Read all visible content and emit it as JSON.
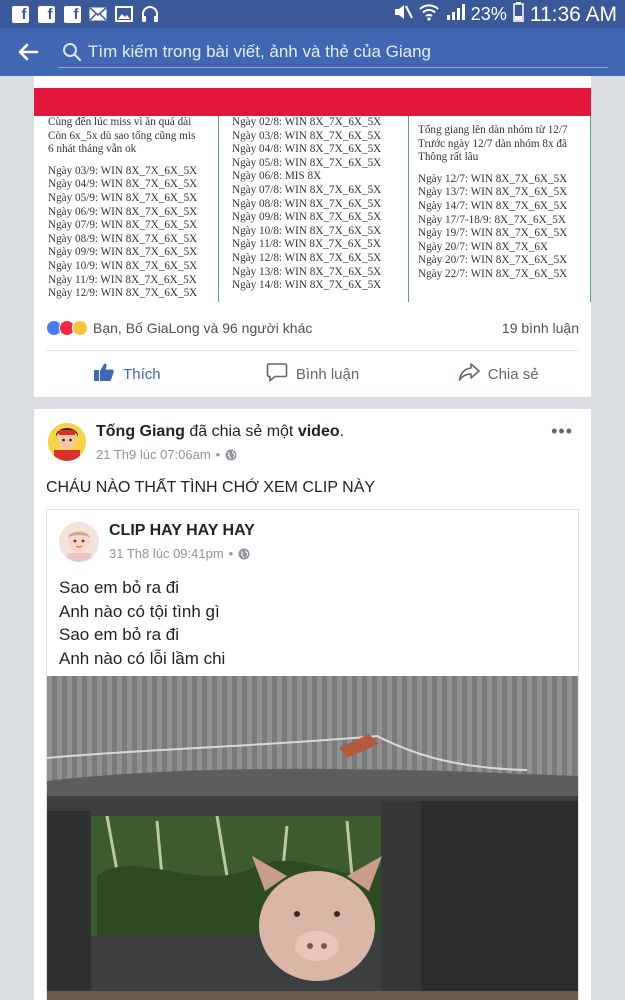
{
  "status_bar": {
    "battery": "23%",
    "time": "11:36 AM"
  },
  "search": {
    "placeholder": "Tìm kiếm trong bài viết, ảnh và thẻ của Giang"
  },
  "post1": {
    "image_text": {
      "col_a": [
        "Cùng đến lúc miss vì ăn quá dài",
        "Còn 6x_5x dù sao tổng cũng mis",
        "6 nhát tháng vẫn ok",
        "",
        "Ngày 03/9: WIN 8X_7X_6X_5X",
        "Ngày 04/9: WIN 8X_7X_6X_5X",
        "Ngày 05/9: WIN 8X_7X_6X_5X",
        "Ngày 06/9: WIN 8X_7X_6X_5X",
        "Ngày 07/9: WIN 8X_7X_6X_5X",
        "Ngày 08/9: WIN 8X_7X_6X_5X",
        "Ngày 09/9: WIN 8X_7X_6X_5X",
        "Ngày 10/9: WIN 8X_7X_6X_5X",
        "Ngày 11/9: WIN 8X_7X_6X_5X",
        "Ngày 12/9: WIN 8X_7X_6X_5X"
      ],
      "col_b": [
        "Ngày 02/8: WIN 8X_7X_6X_5X",
        "Ngày 03/8: WIN 8X_7X_6X_5X",
        "Ngày 04/8: WIN 8X_7X_6X_5X",
        "Ngày 05/8: WIN 8X_7X_6X_5X",
        "Ngày 06/8: MIS 8X",
        "Ngày 07/8: WIN 8X_7X_6X_5X",
        "Ngày 08/8: WIN 8X_7X_6X_5X",
        "Ngày 09/8: WIN 8X_7X_6X_5X",
        "Ngày 10/8: WIN 8X_7X_6X_5X",
        "Ngày 11/8: WIN 8X_7X_6X_5X",
        "Ngày 12/8: WIN 8X_7X_6X_5X",
        "Ngày 13/8: WIN 8X_7X_6X_5X",
        "Ngày 14/8: WIN 8X_7X_6X_5X"
      ],
      "col_c": [
        "",
        "Tổng giang lên dàn nhóm từ 12/7",
        "Trước ngày 12/7 dàn nhóm 8x đã",
        "Thông rất lâu",
        "",
        "Ngày 12/7: WIN 8X_7X_6X_5X",
        "Ngày 13/7: WIN 8X_7X_6X_5X",
        "Ngày 14/7: WIN 8X_7X_6X_5X",
        "Ngày 17/7-18/9: 8X_7X_6X_5X",
        "Ngày 19/7: WIN 8X_7X_6X_5X",
        "Ngày 20/7: WIN 8X_7X_6X",
        "Ngày 20/7: WIN 8X_7X_6X_5X",
        "Ngày 22/7: WIN 8X_7X_6X_5X"
      ]
    },
    "reactions_text": "Bạn, Bố GiaLong và 96 người khác",
    "comments_count": "19 bình luận",
    "actions": {
      "like": "Thích",
      "comment": "Bình luận",
      "share": "Chia sẻ"
    },
    "colors": {
      "banner": "#e3173e",
      "like_blue": "#4267b2"
    }
  },
  "post2": {
    "author": "Tống Giang",
    "action_text": " đã chia sẻ một ",
    "object": "video",
    "period": ".",
    "timestamp": "21 Th9 lúc 07:06am",
    "dot": "•",
    "text": "CHÁU NÀO THẤT TÌNH CHỚ XEM CLIP NÀY",
    "shared": {
      "page_name": "CLIP HAY HAY HAY",
      "timestamp": "31 Th8 lúc 09:41pm",
      "dot": "•",
      "lines": [
        "Sao em bỏ ra đi",
        "Anh nào có tội tình gì",
        "Sao em bỏ ra đi",
        "Anh nào có lỗi lầm chi"
      ]
    }
  }
}
